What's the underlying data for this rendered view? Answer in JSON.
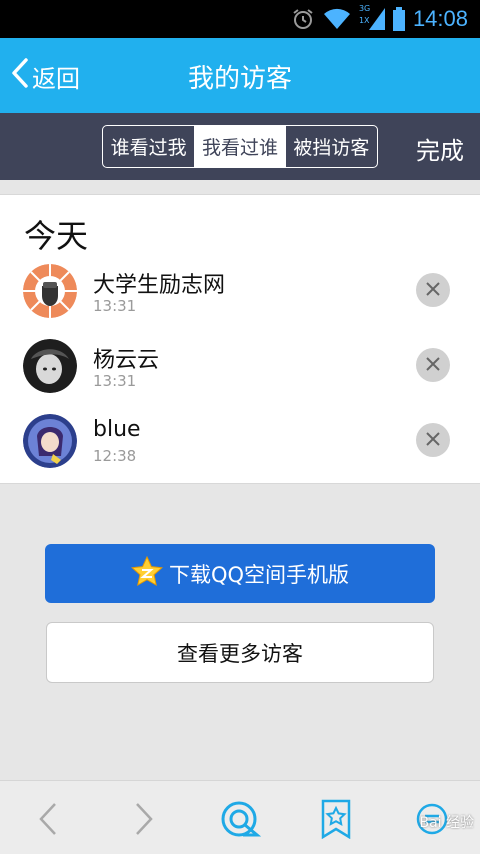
{
  "status_bar": {
    "time": "14:08",
    "network_type": "3G",
    "network_sub": "1X"
  },
  "header": {
    "back_label": "返回",
    "title": "我的访客"
  },
  "tabs": {
    "items": [
      {
        "label": "谁看过我",
        "active": false
      },
      {
        "label": "我看过谁",
        "active": true
      },
      {
        "label": "被挡访客",
        "active": false
      }
    ],
    "done_label": "完成"
  },
  "visitors": {
    "section_title": "今天",
    "items": [
      {
        "name": "大学生励志网",
        "time": "13:31"
      },
      {
        "name": "杨云云",
        "time": "13:31"
      },
      {
        "name": "blue",
        "time": "12:38"
      }
    ]
  },
  "actions": {
    "download_label": "下载QQ空间手机版",
    "more_label": "查看更多访客"
  },
  "bottom_nav": {
    "icons": [
      "back-arrow-icon",
      "forward-arrow-icon",
      "qq-browser-icon",
      "bookmark-star-icon",
      "menu-icon"
    ]
  },
  "watermark": {
    "text": "Bai 经验"
  },
  "colors": {
    "accent": "#21b0ee",
    "tab_bar": "#3f4459",
    "primary_button": "#1f6ed9"
  }
}
